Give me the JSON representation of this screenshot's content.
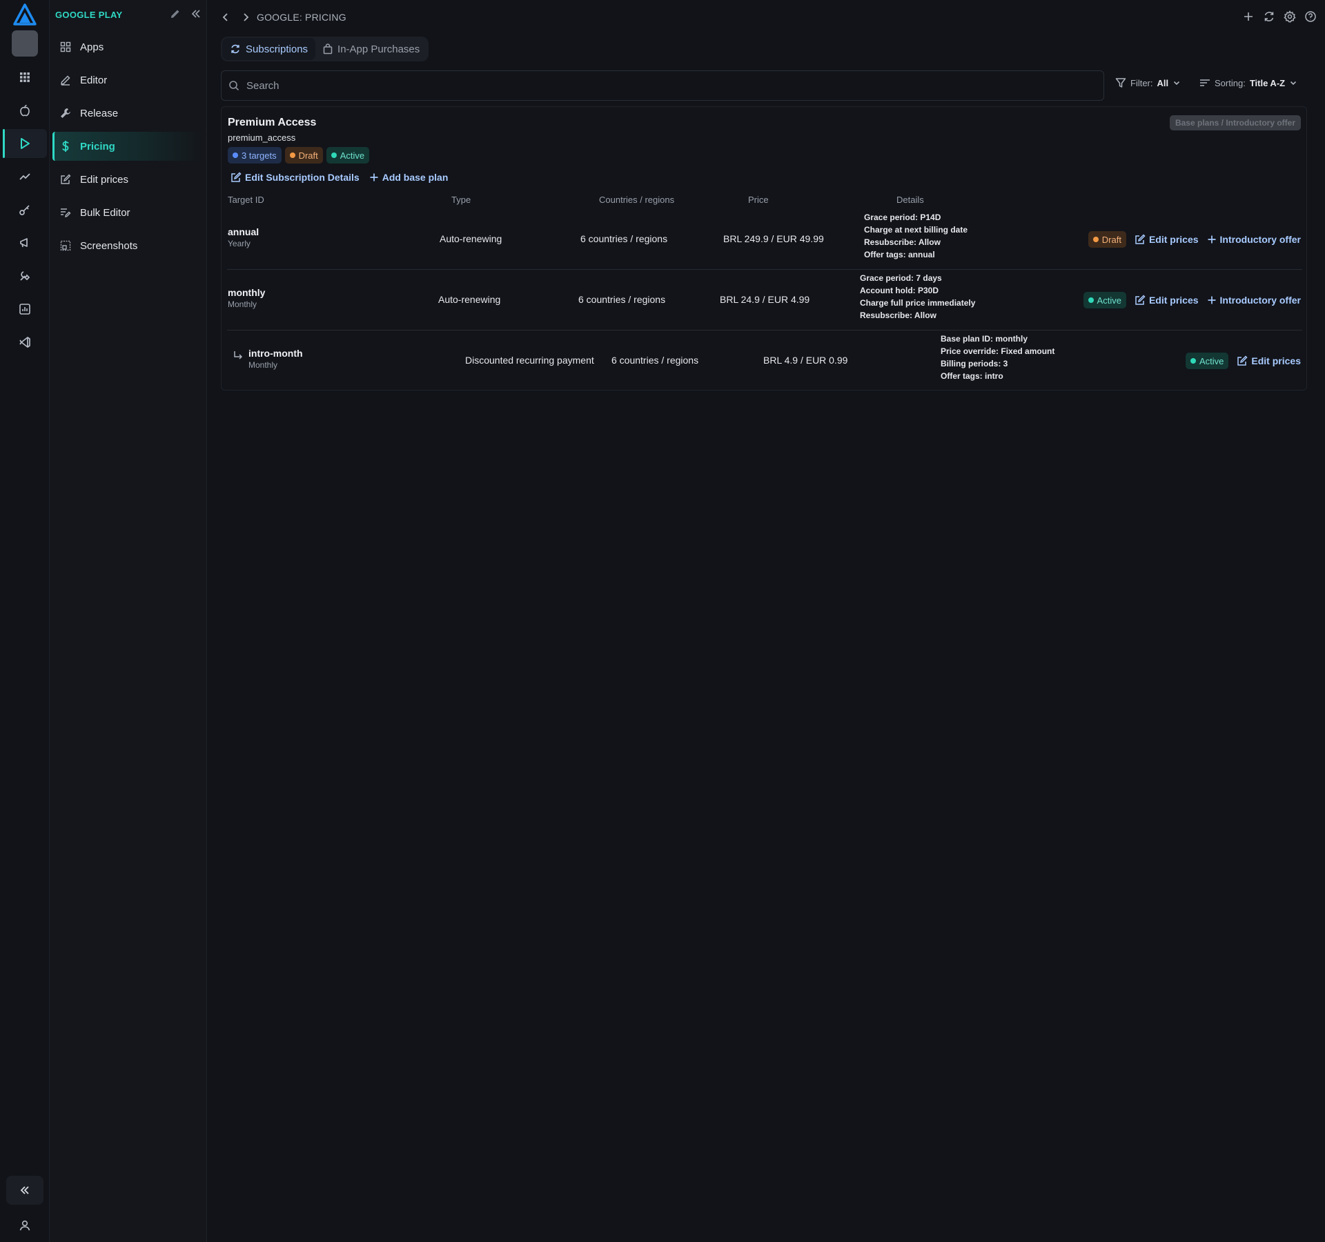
{
  "nav": {
    "title": "GOOGLE PLAY",
    "items": [
      {
        "label": "Apps",
        "icon": "apps-grid-icon"
      },
      {
        "label": "Editor",
        "icon": "pencil-icon"
      },
      {
        "label": "Release",
        "icon": "wrench-icon"
      },
      {
        "label": "Pricing",
        "icon": "dollar-icon"
      },
      {
        "label": "Edit prices",
        "icon": "edit-square-icon"
      },
      {
        "label": "Bulk Editor",
        "icon": "bulk-edit-icon"
      },
      {
        "label": "Screenshots",
        "icon": "screenshots-icon"
      }
    ]
  },
  "topbar": {
    "title": "GOOGLE: PRICING"
  },
  "tabs": [
    {
      "label": "Subscriptions",
      "icon": "refresh-icon",
      "active": true
    },
    {
      "label": "In-App Purchases",
      "icon": "bag-icon",
      "active": false
    }
  ],
  "search": {
    "placeholder": "Search",
    "value": ""
  },
  "filter": {
    "label": "Filter:",
    "value": "All"
  },
  "sorting": {
    "label": "Sorting:",
    "value": "Title A-Z"
  },
  "subscription": {
    "title": "Premium Access",
    "id": "premium_access",
    "disabled_button": "Base plans / Introductory offer",
    "badges": {
      "targets": "3 targets",
      "draft": "Draft",
      "active": "Active"
    },
    "actions": {
      "edit_details": "Edit Subscription Details",
      "add_base_plan": "Add base plan"
    },
    "columns": {
      "target_id": "Target ID",
      "type": "Type",
      "countries": "Countries / regions",
      "price": "Price",
      "details": "Details"
    },
    "rows": [
      {
        "id": "annual",
        "sub": "Yearly",
        "type": "Auto-renewing",
        "countries": "6 countries / regions",
        "price": "BRL 249.9 / EUR 49.99",
        "details": [
          "Grace period: P14D",
          "Charge at next billing date",
          "Resubscribe: Allow",
          "Offer tags: annual"
        ],
        "status": "Draft",
        "edit_prices": "Edit prices",
        "intro_offer": "Introductory offer"
      },
      {
        "id": "monthly",
        "sub": "Monthly",
        "type": "Auto-renewing",
        "countries": "6 countries / regions",
        "price": "BRL 24.9 / EUR 4.99",
        "details": [
          "Grace period: 7 days",
          "Account hold: P30D",
          "Charge full price immediately",
          "Resubscribe: Allow"
        ],
        "status": "Active",
        "edit_prices": "Edit prices",
        "intro_offer": "Introductory offer"
      },
      {
        "id": "intro-month",
        "sub": "Monthly",
        "type": "Discounted recurring payment",
        "countries": "6 countries / regions",
        "price": "BRL 4.9 / EUR 0.99",
        "details": [
          "Base plan ID: monthly",
          "Price override: Fixed amount",
          "Billing periods: 3",
          "Offer tags: intro"
        ],
        "status": "Active",
        "edit_prices": "Edit prices"
      }
    ]
  },
  "colors": {
    "accent": "#2fd9c5",
    "link": "#a9cbff",
    "draft": "#f39a45",
    "active": "#2fd9b8",
    "background": "#111318"
  }
}
